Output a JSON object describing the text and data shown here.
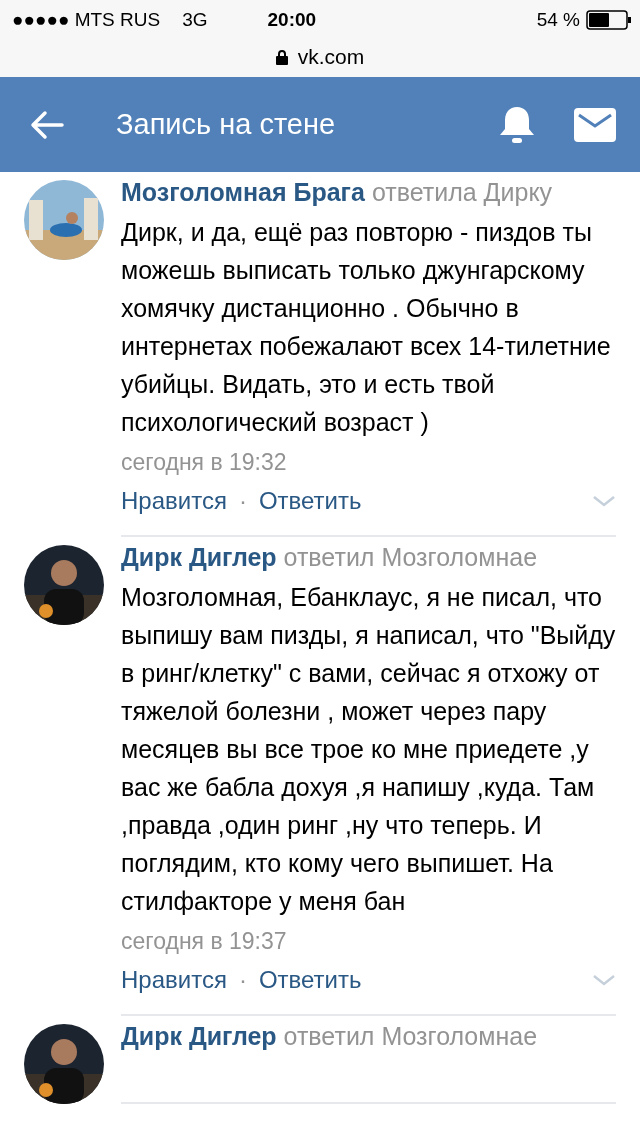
{
  "status_bar": {
    "carrier": "●●●●● MTS RUS",
    "network": "3G",
    "time": "20:00",
    "battery_text": "54 %"
  },
  "url_bar": {
    "address": "vk.com"
  },
  "header": {
    "title": "Запись на стене"
  },
  "comments": [
    {
      "author": "Мозголомная Брага",
      "reply_to": "ответила Дирку",
      "text": "Дирк, и да, ещё раз повторю - пиздов ты можешь выписать только джунгарскому хомячку дистанционно . Обычно в интернетах побежалают всех 14-тилетние убийцы. Видать, это и есть твой психологический возраст )",
      "time": "сегодня в 19:32",
      "like": "Нравится",
      "separator": "·",
      "reply": "Ответить"
    },
    {
      "author": "Дирк Диглер",
      "reply_to": "ответил Мозголомнае",
      "text": "Мозголомная, Ебанклаус, я не писал, что выпишу вам пизды, я написал, что \"Выйду в ринг/клетку\" с вами, сейчас я отхожу от тяжелой болезни , может через пару месяцев вы все трое ко мне приедете ,у вас же бабла дохуя ,я напишу ,куда. Там ,правда ,один ринг ,ну что теперь. И поглядим, кто кому чего выпишет. На стилфакторе у меня бан",
      "time": "сегодня в 19:37",
      "like": "Нравится",
      "separator": "·",
      "reply": "Ответить"
    },
    {
      "author": "Дирк Диглер",
      "reply_to": "ответил Мозголомнае"
    }
  ]
}
